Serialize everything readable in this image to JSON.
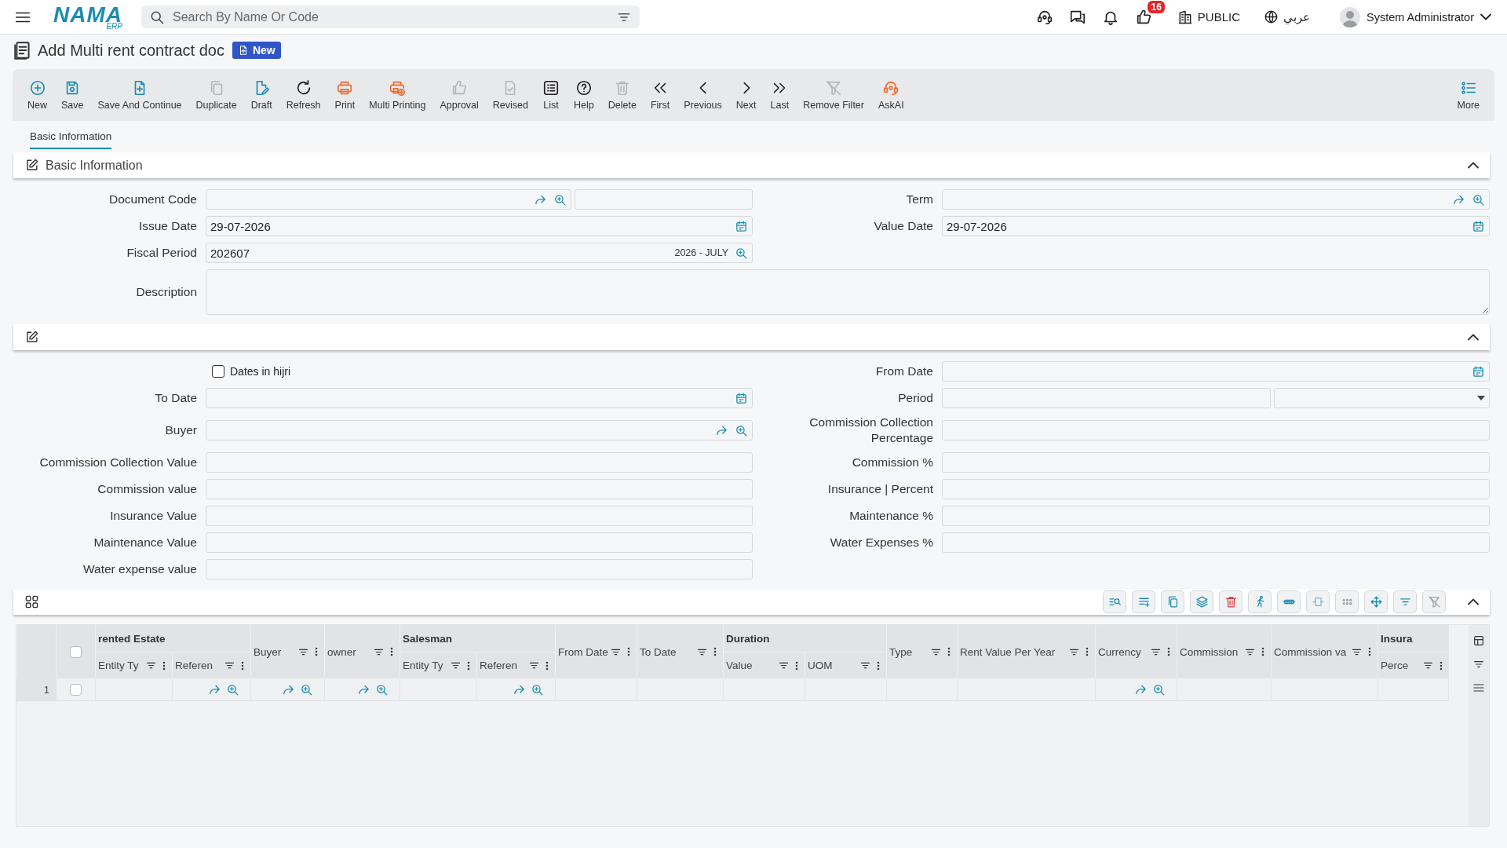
{
  "topbar": {
    "logo": "NAMA",
    "logo_sub": "ERP",
    "search": {
      "placeholder": "Search By Name Or Code"
    },
    "notification_count": "16",
    "company": "PUBLIC",
    "language": "عربي",
    "user": "System Administrator"
  },
  "page": {
    "title": "Add Multi rent contract doc",
    "status": "New"
  },
  "toolbar": [
    {
      "label": "New",
      "disabled": false
    },
    {
      "label": "Save",
      "disabled": false
    },
    {
      "label": "Save And Continue",
      "disabled": false
    },
    {
      "label": "Duplicate",
      "disabled": true
    },
    {
      "label": "Draft",
      "disabled": false
    },
    {
      "label": "Refresh",
      "disabled": false
    },
    {
      "label": "Print",
      "disabled": false
    },
    {
      "label": "Multi Printing",
      "disabled": false
    },
    {
      "label": "Approval",
      "disabled": true
    },
    {
      "label": "Revised",
      "disabled": true
    },
    {
      "label": "List",
      "disabled": false
    },
    {
      "label": "Help",
      "disabled": false
    },
    {
      "label": "Delete",
      "disabled": true
    },
    {
      "label": "First",
      "disabled": false
    },
    {
      "label": "Previous",
      "disabled": false
    },
    {
      "label": "Next",
      "disabled": false
    },
    {
      "label": "Last",
      "disabled": false
    },
    {
      "label": "Remove Filter",
      "disabled": true
    },
    {
      "label": "AskAI",
      "disabled": false
    }
  ],
  "more": "More",
  "tabs": [
    {
      "label": "Basic Information",
      "selected": true
    }
  ],
  "sections": [
    {
      "title": "Basic Information",
      "expanded": true,
      "left": [
        {
          "kind": "lookup-pair",
          "label": "Document Code"
        },
        {
          "kind": "date",
          "label": "Issue Date",
          "value": "29-07-2026"
        },
        {
          "kind": "fiscal",
          "label": "Fiscal Period",
          "value": "202607",
          "hint": "2026 - JULY"
        }
      ],
      "right": [
        {
          "kind": "lookup",
          "label": "Term"
        },
        {
          "kind": "date",
          "label": "Value Date",
          "value": "29-07-2026"
        }
      ],
      "wide": [
        {
          "kind": "textarea",
          "label": "Description"
        }
      ]
    },
    {
      "expanded": true,
      "left": [
        {
          "kind": "checkbox",
          "label": "Dates in hijri",
          "checked": false
        },
        {
          "kind": "date",
          "label": "To Date"
        },
        {
          "kind": "lookup",
          "label": "Buyer"
        },
        {
          "kind": "text",
          "label": "Commission Collection Value"
        },
        {
          "kind": "text",
          "label": "Commission value"
        },
        {
          "kind": "text",
          "label": "Insurance Value"
        },
        {
          "kind": "text",
          "label": "Maintenance Value"
        },
        {
          "kind": "text",
          "label": "Water expense value"
        }
      ],
      "right": [
        {
          "kind": "date",
          "label": "From Date"
        },
        {
          "kind": "select-pair",
          "label": "Period"
        },
        {
          "kind": "text",
          "label": "Commission Collection Percentage"
        },
        {
          "kind": "text",
          "label": "Commission %"
        },
        {
          "kind": "text",
          "label": "Insurance | Percent"
        },
        {
          "kind": "text",
          "label": "Maintenance %"
        },
        {
          "kind": "text",
          "label": "Water Expenses %"
        }
      ]
    }
  ],
  "grid": {
    "expanded": true,
    "header_checked": false,
    "columns": [
      {
        "label": "rented Estate",
        "children": [
          {
            "label": "Entity Ty"
          },
          {
            "label": "Referen"
          }
        ]
      },
      {
        "label": "Buyer"
      },
      {
        "label": "owner"
      },
      {
        "label": "Salesman",
        "children": [
          {
            "label": "Entity Ty"
          },
          {
            "label": "Referen"
          }
        ]
      },
      {
        "label": "From Date"
      },
      {
        "label": "To Date"
      },
      {
        "label": "Duration",
        "children": [
          {
            "label": "Value"
          },
          {
            "label": "UOM"
          }
        ]
      },
      {
        "label": "Type"
      },
      {
        "label": "Rent Value Per Year"
      },
      {
        "label": "Currency"
      },
      {
        "label": "Commission"
      },
      {
        "label": "Commission va"
      },
      {
        "label": "Insura",
        "children": [
          {
            "label": "Perce"
          }
        ]
      }
    ],
    "rows": [
      {
        "number": "1",
        "checked": false,
        "cells": [
          {
            "kind": "plain"
          },
          {
            "kind": "lookup"
          },
          {
            "kind": "lookup"
          },
          {
            "kind": "lookup"
          },
          {
            "kind": "plain"
          },
          {
            "kind": "lookup"
          },
          {
            "kind": "plain"
          },
          {
            "kind": "plain"
          },
          {
            "kind": "plain"
          },
          {
            "kind": "plain"
          },
          {
            "kind": "plain"
          },
          {
            "kind": "plain"
          },
          {
            "kind": "lookup"
          },
          {
            "kind": "plain"
          },
          {
            "kind": "plain"
          },
          {
            "kind": "plain"
          }
        ]
      }
    ]
  }
}
